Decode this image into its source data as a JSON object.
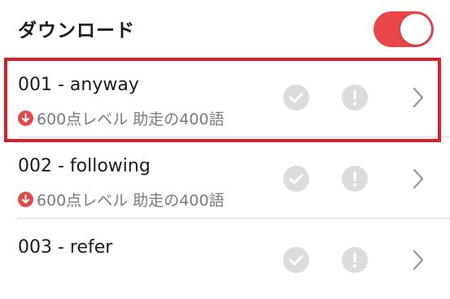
{
  "header": {
    "title": "ダウンロード",
    "toggle_on": true,
    "toggle_color": "#e9464a"
  },
  "rows": [
    {
      "title": "001 - anyway",
      "subtitle": "600点レベル 助走の400語",
      "icons": [
        "download-icon",
        "check-icon",
        "alert-icon",
        "chevron-right-icon"
      ]
    },
    {
      "title": "002 - following",
      "subtitle": "600点レベル 助走の400語",
      "icons": [
        "download-icon",
        "check-icon",
        "alert-icon",
        "chevron-right-icon"
      ]
    },
    {
      "title": "003 - refer",
      "icons": [
        "check-icon",
        "alert-icon",
        "chevron-right-icon"
      ]
    }
  ],
  "highlight_color": "#d8202a",
  "status_color": "#e04a4a"
}
